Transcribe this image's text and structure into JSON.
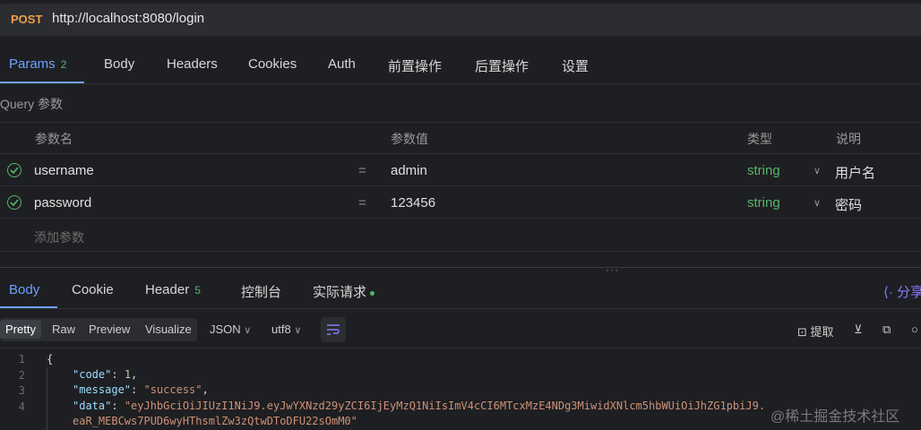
{
  "url_bar": {
    "method": "POST",
    "url": "http://localhost:8080/login"
  },
  "request_tabs": [
    {
      "label": "Params",
      "badge": "2"
    },
    {
      "label": "Body"
    },
    {
      "label": "Headers"
    },
    {
      "label": "Cookies"
    },
    {
      "label": "Auth"
    },
    {
      "label": "前置操作"
    },
    {
      "label": "后置操作"
    },
    {
      "label": "设置"
    }
  ],
  "query_section": {
    "label": "Query 参数"
  },
  "params_table": {
    "headers": {
      "name": "参数名",
      "value": "参数值",
      "type": "类型",
      "desc": "说明"
    },
    "rows": [
      {
        "name": "username",
        "eq": "=",
        "value": "admin",
        "type": "string",
        "desc": "用户名"
      },
      {
        "name": "password",
        "eq": "=",
        "value": "123456",
        "type": "string",
        "desc": "密码"
      }
    ],
    "add_placeholder": "添加参数"
  },
  "resize_handle": "···",
  "response_tabs": [
    {
      "label": "Body"
    },
    {
      "label": "Cookie"
    },
    {
      "label": "Header",
      "badge": "5"
    },
    {
      "label": "控制台"
    },
    {
      "label": "实际请求"
    }
  ],
  "share_label": "分享",
  "response_toolbar": {
    "views": [
      "Pretty",
      "Raw",
      "Preview",
      "Visualize"
    ],
    "format": "JSON",
    "encoding": "utf8",
    "extract_label": "提取"
  },
  "code_lines": {
    "line_numbers": [
      "1",
      "2",
      "3",
      "4"
    ],
    "open_brace": "{",
    "code_key": "\"code\"",
    "code_val": "1",
    "message_key": "\"message\"",
    "message_val": "\"success\"",
    "data_key": "\"data\"",
    "data_val_1": "\"eyJhbGciOiJIUzI1NiJ9.eyJwYXNzd29yZCI6IjEyMzQ1NiIsImV4cCI6MTcxMzE4NDg3MiwidXNlcm5hbWUiOiJhZG1pbiJ9.",
    "data_val_2": "eaR_MEBCws7PUD6wyHThsmlZw3zQtwDToDFU22sOmM0\""
  },
  "watermark": "@稀土掘金技术社区",
  "colors": {
    "accent": "#6ea1ff",
    "method": "#f0a04b",
    "type_green": "#57b56a",
    "share": "#8b7bff"
  }
}
